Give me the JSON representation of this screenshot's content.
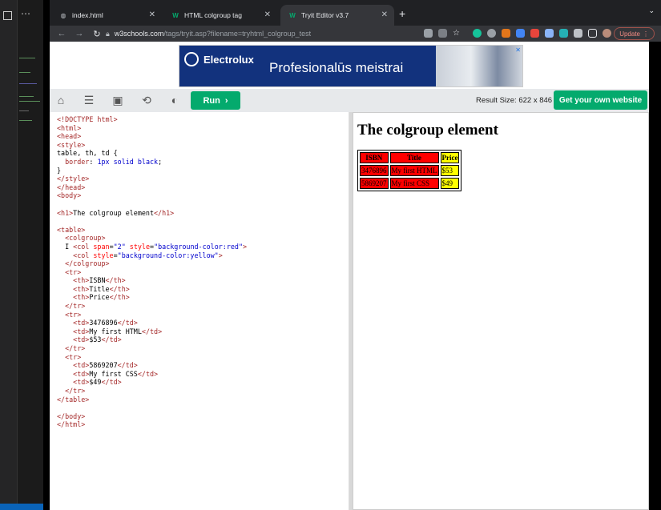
{
  "tabs": [
    {
      "label": "index.html",
      "icon": "globe-icon"
    },
    {
      "label": "HTML colgroup tag",
      "icon": "w3schools-icon"
    },
    {
      "label": "Tryit Editor v3.7",
      "icon": "w3schools-icon"
    }
  ],
  "address": {
    "domain": "w3schools.com",
    "path": "/tags/tryit.asp?filename=tryhtml_colgroup_test"
  },
  "update_label": "Update",
  "ad": {
    "brand": "Electrolux",
    "slogan": "Profesionalūs meistrai"
  },
  "tryit": {
    "run_label": "Run",
    "result_size": "Result Size: 622 x 846",
    "own_label": "Get your own website"
  },
  "code_lines": [
    [
      [
        "tg",
        "<!DOCTYPE html>"
      ]
    ],
    [
      [
        "tg",
        "<html>"
      ]
    ],
    [
      [
        "tg",
        "<head>"
      ]
    ],
    [
      [
        "tg",
        "<style>"
      ]
    ],
    [
      [
        "pl",
        "table, th, td {"
      ]
    ],
    [
      [
        "pl",
        "  "
      ],
      [
        "cp",
        "border"
      ],
      [
        "pl",
        ": "
      ],
      [
        "cv",
        "1px solid black"
      ],
      [
        "pl",
        ";"
      ]
    ],
    [
      [
        "pl",
        "}"
      ]
    ],
    [
      [
        "tg",
        "</style>"
      ]
    ],
    [
      [
        "tg",
        "</head>"
      ]
    ],
    [
      [
        "tg",
        "<body>"
      ]
    ],
    [],
    [
      [
        "tg",
        "<h1>"
      ],
      [
        "pl",
        "The colgroup element"
      ],
      [
        "tg",
        "</h1>"
      ]
    ],
    [],
    [
      [
        "tg",
        "<table>"
      ]
    ],
    [
      [
        "pl",
        "  "
      ],
      [
        "tg",
        "<colgroup>"
      ]
    ],
    [
      [
        "pl",
        "  I "
      ],
      [
        "tg",
        "<col "
      ],
      [
        "at",
        "span"
      ],
      [
        "pl",
        "="
      ],
      [
        "av",
        "\"2\""
      ],
      [
        "at",
        " style"
      ],
      [
        "pl",
        "="
      ],
      [
        "av",
        "\"background-color:red\""
      ],
      [
        "tg",
        ">"
      ]
    ],
    [
      [
        "pl",
        "    "
      ],
      [
        "tg",
        "<col "
      ],
      [
        "at",
        "style"
      ],
      [
        "pl",
        "="
      ],
      [
        "av",
        "\"background-color:yellow\""
      ],
      [
        "tg",
        ">"
      ]
    ],
    [
      [
        "pl",
        "  "
      ],
      [
        "tg",
        "</colgroup>"
      ]
    ],
    [
      [
        "pl",
        "  "
      ],
      [
        "tg",
        "<tr>"
      ]
    ],
    [
      [
        "pl",
        "    "
      ],
      [
        "tg",
        "<th>"
      ],
      [
        "pl",
        "ISBN"
      ],
      [
        "tg",
        "</th>"
      ]
    ],
    [
      [
        "pl",
        "    "
      ],
      [
        "tg",
        "<th>"
      ],
      [
        "pl",
        "Title"
      ],
      [
        "tg",
        "</th>"
      ]
    ],
    [
      [
        "pl",
        "    "
      ],
      [
        "tg",
        "<th>"
      ],
      [
        "pl",
        "Price"
      ],
      [
        "tg",
        "</th>"
      ]
    ],
    [
      [
        "pl",
        "  "
      ],
      [
        "tg",
        "</tr>"
      ]
    ],
    [
      [
        "pl",
        "  "
      ],
      [
        "tg",
        "<tr>"
      ]
    ],
    [
      [
        "pl",
        "    "
      ],
      [
        "tg",
        "<td>"
      ],
      [
        "pl",
        "3476896"
      ],
      [
        "tg",
        "</td>"
      ]
    ],
    [
      [
        "pl",
        "    "
      ],
      [
        "tg",
        "<td>"
      ],
      [
        "pl",
        "My first HTML"
      ],
      [
        "tg",
        "</td>"
      ]
    ],
    [
      [
        "pl",
        "    "
      ],
      [
        "tg",
        "<td>"
      ],
      [
        "pl",
        "$53"
      ],
      [
        "tg",
        "</td>"
      ]
    ],
    [
      [
        "pl",
        "  "
      ],
      [
        "tg",
        "</tr>"
      ]
    ],
    [
      [
        "pl",
        "  "
      ],
      [
        "tg",
        "<tr>"
      ]
    ],
    [
      [
        "pl",
        "    "
      ],
      [
        "tg",
        "<td>"
      ],
      [
        "pl",
        "5869207"
      ],
      [
        "tg",
        "</td>"
      ]
    ],
    [
      [
        "pl",
        "    "
      ],
      [
        "tg",
        "<td>"
      ],
      [
        "pl",
        "My first CSS"
      ],
      [
        "tg",
        "</td>"
      ]
    ],
    [
      [
        "pl",
        "    "
      ],
      [
        "tg",
        "<td>"
      ],
      [
        "pl",
        "$49"
      ],
      [
        "tg",
        "</td>"
      ]
    ],
    [
      [
        "pl",
        "  "
      ],
      [
        "tg",
        "</tr>"
      ]
    ],
    [
      [
        "tg",
        "</table>"
      ]
    ],
    [],
    [
      [
        "tg",
        "</body>"
      ]
    ],
    [
      [
        "tg",
        "</html>"
      ]
    ]
  ],
  "result": {
    "heading": "The colgroup element",
    "headers": [
      "ISBN",
      "Title",
      "Price"
    ],
    "rows": [
      [
        "3476896",
        "My first HTML",
        "$53"
      ],
      [
        "5869207",
        "My first CSS",
        "$49"
      ]
    ]
  },
  "colors": {
    "run_green": "#04aa6d",
    "col_red": "#ff0000",
    "col_yellow": "#ffff00"
  }
}
